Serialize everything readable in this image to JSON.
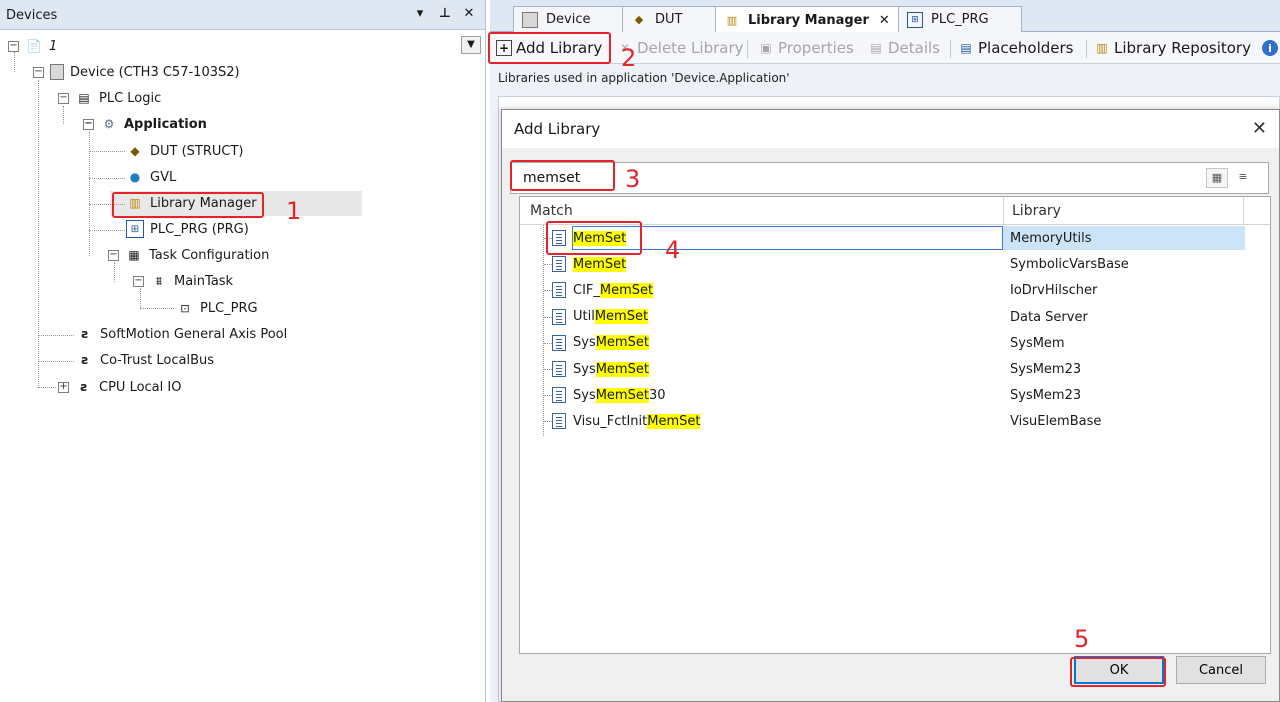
{
  "devices_panel": {
    "title": "Devices",
    "header_buttons": {
      "dropdown": "▾",
      "pin": "⊥",
      "close": "✕"
    },
    "tree": [
      {
        "label": "1",
        "icon": "project-icon"
      },
      {
        "label": "Device (CTH3 C57-103S2)",
        "icon": "device-icon"
      },
      {
        "label": "PLC Logic",
        "icon": "plc-logic-icon"
      },
      {
        "label": "Application",
        "icon": "application-gear-icon"
      },
      {
        "label": "DUT (STRUCT)",
        "icon": "dut-icon"
      },
      {
        "label": "GVL",
        "icon": "globe-icon"
      },
      {
        "label": "Library Manager",
        "icon": "library-books-icon"
      },
      {
        "label": "PLC_PRG (PRG)",
        "icon": "program-icon"
      },
      {
        "label": "Task Configuration",
        "icon": "task-config-icon"
      },
      {
        "label": "MainTask",
        "icon": "task-icon"
      },
      {
        "label": "PLC_PRG",
        "icon": "program-call-icon"
      },
      {
        "label": "SoftMotion General Axis Pool",
        "icon": "axis-icon"
      },
      {
        "label": "Co-Trust LocalBus",
        "icon": "bus-icon"
      },
      {
        "label": "CPU Local IO",
        "icon": "io-icon"
      }
    ]
  },
  "tabs": [
    {
      "label": "Device",
      "icon": "device-icon"
    },
    {
      "label": "DUT",
      "icon": "dut-icon"
    },
    {
      "label": "Library Manager",
      "icon": "library-books-icon",
      "active": true,
      "close": "✕"
    },
    {
      "label": "PLC_PRG",
      "icon": "program-icon"
    }
  ],
  "toolbar": {
    "add_library": "Add Library",
    "delete_library": "Delete Library",
    "properties": "Properties",
    "details": "Details",
    "placeholders": "Placeholders",
    "library_repository": "Library Repository"
  },
  "libs_used_label": "Libraries used in application 'Device.Application'",
  "dialog": {
    "title": "Add Library",
    "close": "✕",
    "search_value": "memset",
    "columns": {
      "match": "Match",
      "library": "Library"
    },
    "results": [
      {
        "pre": "",
        "hl": "MemSet",
        "post": "",
        "library": "MemoryUtils",
        "selected": true
      },
      {
        "pre": "",
        "hl": "MemSet",
        "post": "",
        "library": "SymbolicVarsBase"
      },
      {
        "pre": "CIF_",
        "hl": "MemSet",
        "post": "",
        "library": "IoDrvHilscher"
      },
      {
        "pre": "Util",
        "hl": "MemSet",
        "post": "",
        "library": "Data Server"
      },
      {
        "pre": "Sys",
        "hl": "MemSet",
        "post": "",
        "library": "SysMem"
      },
      {
        "pre": "Sys",
        "hl": "MemSet",
        "post": "",
        "library": "SysMem23"
      },
      {
        "pre": "Sys",
        "hl": "MemSet",
        "post": "30",
        "library": "SysMem23"
      },
      {
        "pre": "Visu_FctInit",
        "hl": "MemSet",
        "post": "",
        "library": "VisuElemBase"
      }
    ],
    "ok": "OK",
    "cancel": "Cancel"
  },
  "annotations": [
    "1",
    "2",
    "3",
    "4",
    "5"
  ],
  "colors": {
    "annotation_red": "#e3242b",
    "highlight_yellow": "#ffff00",
    "selection_blue": "#cce4f7"
  }
}
